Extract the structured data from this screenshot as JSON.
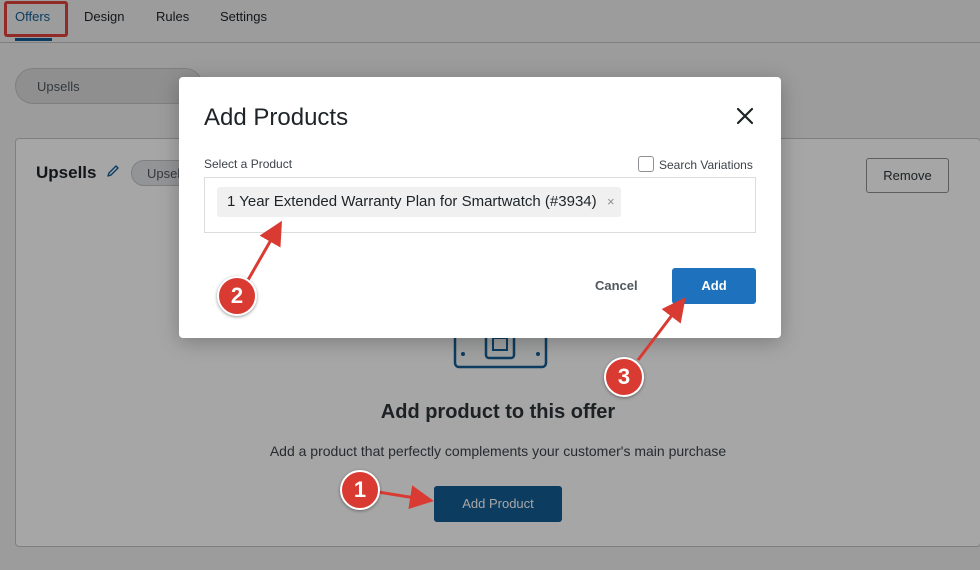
{
  "tabs": [
    {
      "label": "Offers",
      "active": true
    },
    {
      "label": "Design",
      "active": false
    },
    {
      "label": "Rules",
      "active": false
    },
    {
      "label": "Settings",
      "active": false
    }
  ],
  "offer_pill": {
    "label": "Upsells"
  },
  "panel": {
    "title": "Upsells",
    "type_badge": "Upsel",
    "remove_label": "Remove",
    "empty_title": "Add product to this offer",
    "empty_description": "Add a product that perfectly complements your customer's main purchase",
    "add_product_label": "Add Product"
  },
  "modal": {
    "title": "Add Products",
    "select_label": "Select a Product",
    "search_variations_label": "Search Variations",
    "search_variations_checked": false,
    "selected_product": "1 Year Extended Warranty Plan for Smartwatch (#3934)",
    "remove_symbol": "×",
    "cancel_label": "Cancel",
    "add_label": "Add"
  },
  "annotations": [
    {
      "label": "1"
    },
    {
      "label": "2"
    },
    {
      "label": "3"
    }
  ],
  "colors": {
    "accent": "#135e96",
    "modal_add_button": "#1e72bd",
    "annotation_red": "#d93b32",
    "highlight_box": "#e0413a"
  },
  "icons": {
    "close": "close-icon",
    "edit": "pencil-icon",
    "illustration": "product-box-icon"
  }
}
